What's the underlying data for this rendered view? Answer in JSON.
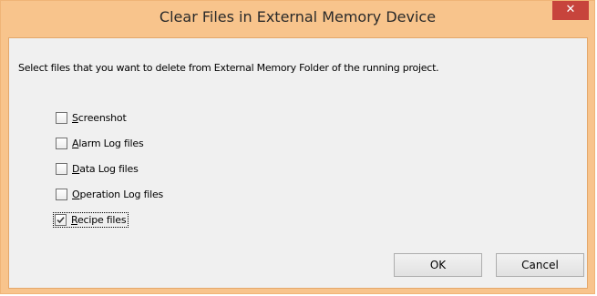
{
  "window": {
    "title": "Clear Files in External Memory Device",
    "close_glyph": "✕"
  },
  "instruction": "Select files that you want to delete from External Memory Folder of the running project.",
  "options": [
    {
      "access_key": "S",
      "rest": "creenshot",
      "checked": false
    },
    {
      "access_key": "A",
      "rest": "larm Log files",
      "checked": false
    },
    {
      "access_key": "D",
      "rest": "ata Log files",
      "checked": false
    },
    {
      "access_key": "O",
      "rest": "peration Log files",
      "checked": false
    },
    {
      "access_key": "R",
      "rest": "ecipe files",
      "checked": true
    }
  ],
  "buttons": {
    "ok": "OK",
    "cancel": "Cancel"
  },
  "colors": {
    "frame": "#f8c48c",
    "close": "#c7443c",
    "client": "#f0f0f0"
  }
}
